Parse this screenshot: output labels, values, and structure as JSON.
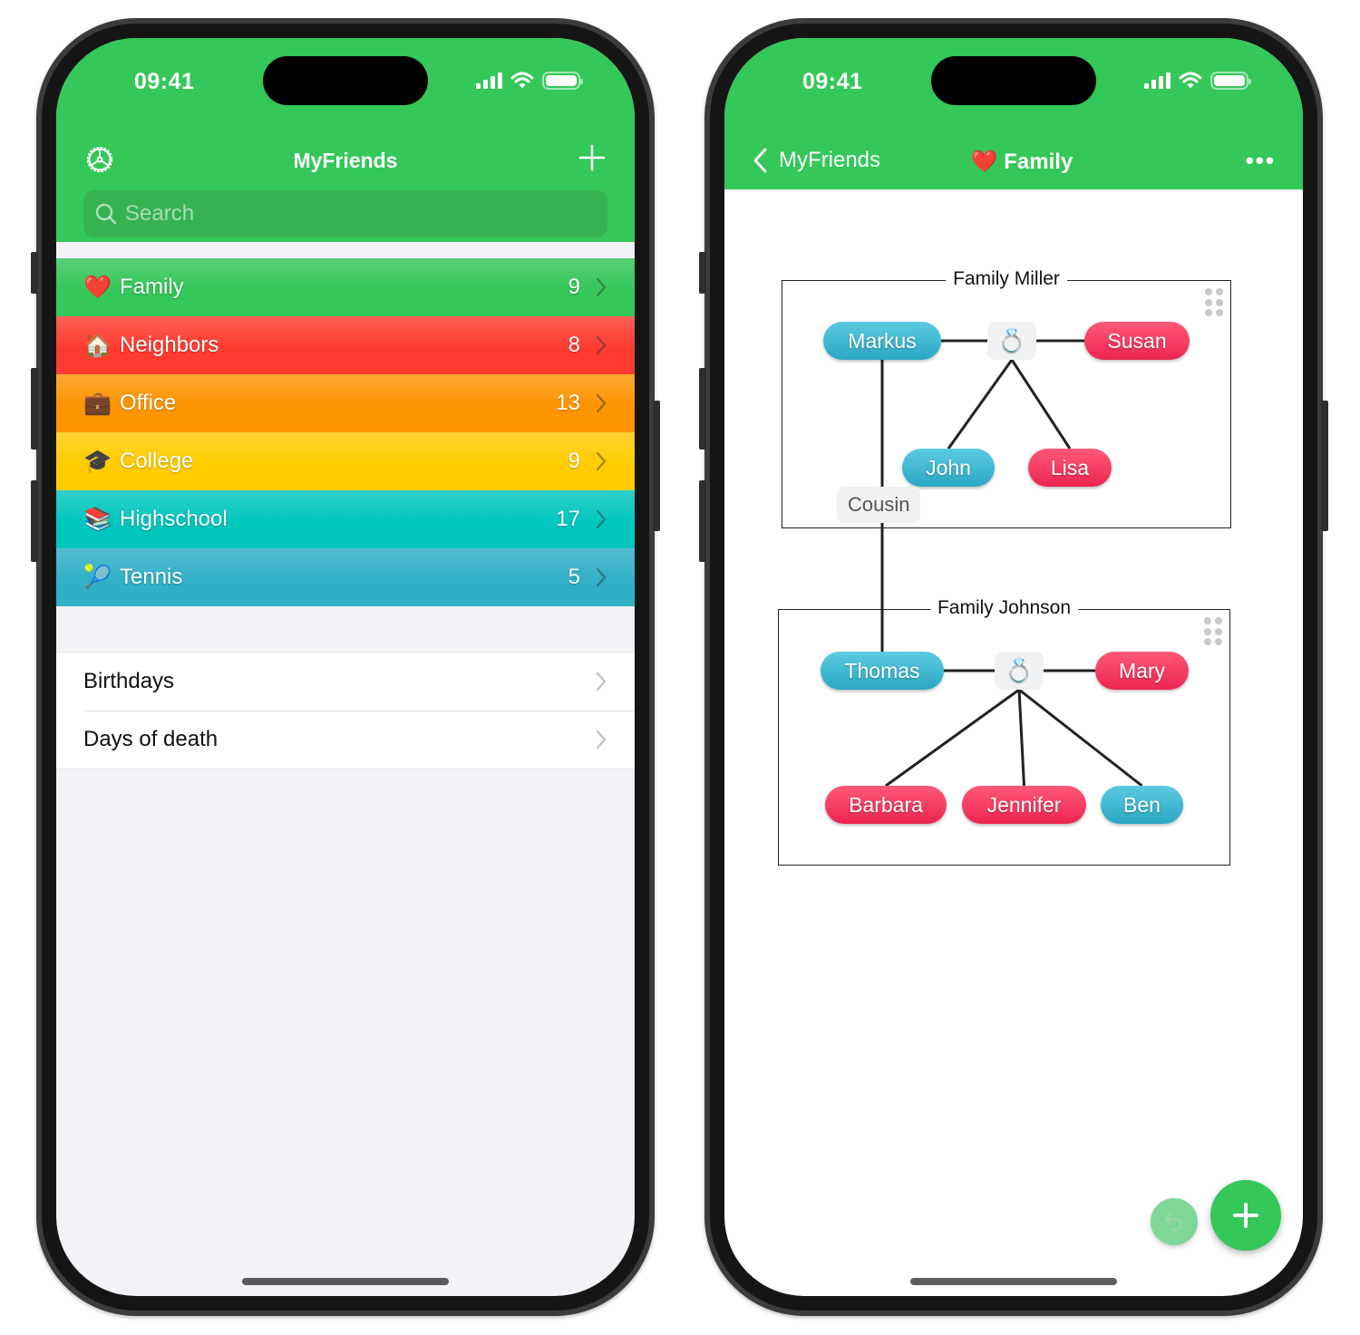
{
  "status_bar": {
    "time": "09:41"
  },
  "left_screen": {
    "nav": {
      "title": "MyFriends",
      "settings_icon": "gear-icon",
      "add_icon": "plus-icon"
    },
    "search": {
      "placeholder": "Search",
      "value": ""
    },
    "groups": [
      {
        "emoji": "❤️",
        "icon": "heart-icon",
        "label": "Family",
        "count": "9",
        "color": "#34c759"
      },
      {
        "emoji": "🏠",
        "icon": "house-icon",
        "label": "Neighbors",
        "count": "8",
        "color": "#ff3b30"
      },
      {
        "emoji": "💼",
        "icon": "briefcase-icon",
        "label": "Office",
        "count": "13",
        "color": "#ff9500"
      },
      {
        "emoji": "🎓",
        "icon": "graduation-cap-icon",
        "label": "College",
        "count": "9",
        "color": "#ffcc00"
      },
      {
        "emoji": "📚",
        "icon": "books-icon",
        "label": "Highschool",
        "count": "17",
        "color": "#00c7be"
      },
      {
        "emoji": "🎾",
        "icon": "tennis-ball-icon",
        "label": "Tennis",
        "count": "5",
        "color": "#30b0c7"
      }
    ],
    "extra_items": [
      {
        "label": "Birthdays"
      },
      {
        "label": "Days of death"
      }
    ]
  },
  "right_screen": {
    "nav": {
      "back_label": "MyFriends",
      "title_emoji": "❤️",
      "title": "Family",
      "more_icon": "ellipsis-icon"
    },
    "families": [
      {
        "title": "Family Miller",
        "partners": [
          {
            "name": "Markus",
            "gender": "male"
          },
          {
            "name": "Susan",
            "gender": "female"
          }
        ],
        "children": [
          {
            "name": "John",
            "gender": "male"
          },
          {
            "name": "Lisa",
            "gender": "female"
          }
        ]
      },
      {
        "title": "Family Johnson",
        "partners": [
          {
            "name": "Thomas",
            "gender": "male"
          },
          {
            "name": "Mary",
            "gender": "female"
          }
        ],
        "children": [
          {
            "name": "Barbara",
            "gender": "female"
          },
          {
            "name": "Jennifer",
            "gender": "female"
          },
          {
            "name": "Ben",
            "gender": "male"
          }
        ]
      }
    ],
    "marriage_icon": "💍",
    "relation": {
      "label": "Cousin",
      "from": "Markus",
      "to": "Thomas"
    },
    "colors": {
      "male": "#2fb0c9",
      "female": "#f22d58",
      "accent": "#34c759"
    }
  }
}
